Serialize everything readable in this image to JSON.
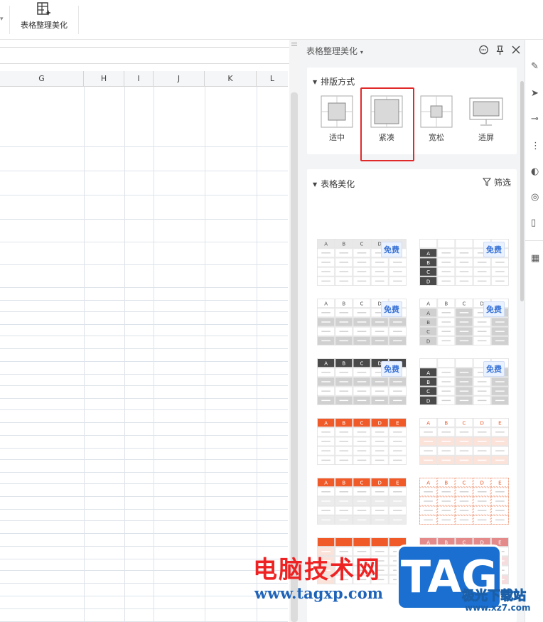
{
  "toolbar": {
    "beautify_label": "表格整理美化"
  },
  "sheet": {
    "columns": [
      "G",
      "H",
      "I",
      "J",
      "K",
      "L"
    ]
  },
  "panel": {
    "title": "表格整理美化",
    "layout_section": {
      "title": "排版方式",
      "options": [
        "适中",
        "紧凑",
        "宽松",
        "适屏"
      ],
      "selected": "紧凑"
    },
    "beautify_section": {
      "title": "表格美化",
      "filter_label": "筛选",
      "free_badge": "免费",
      "header_letters": [
        "A",
        "B",
        "C",
        "D",
        "E"
      ],
      "row_letters": [
        "A",
        "B",
        "C",
        "D"
      ]
    }
  },
  "icons": {
    "panel": [
      "chat-icon",
      "pin-icon",
      "close-icon"
    ],
    "filter": "funnel-icon"
  },
  "colors": {
    "accent": "#f05a28",
    "highlight": "#e02a2a",
    "dark": "#4a4a4a",
    "badge": "#3a73d6"
  },
  "watermark": {
    "title": "电脑技术网",
    "url": "www.tagxp.com",
    "logo": "TAG",
    "site_name": "极光下载站",
    "site_url": "www.xz7.com"
  }
}
